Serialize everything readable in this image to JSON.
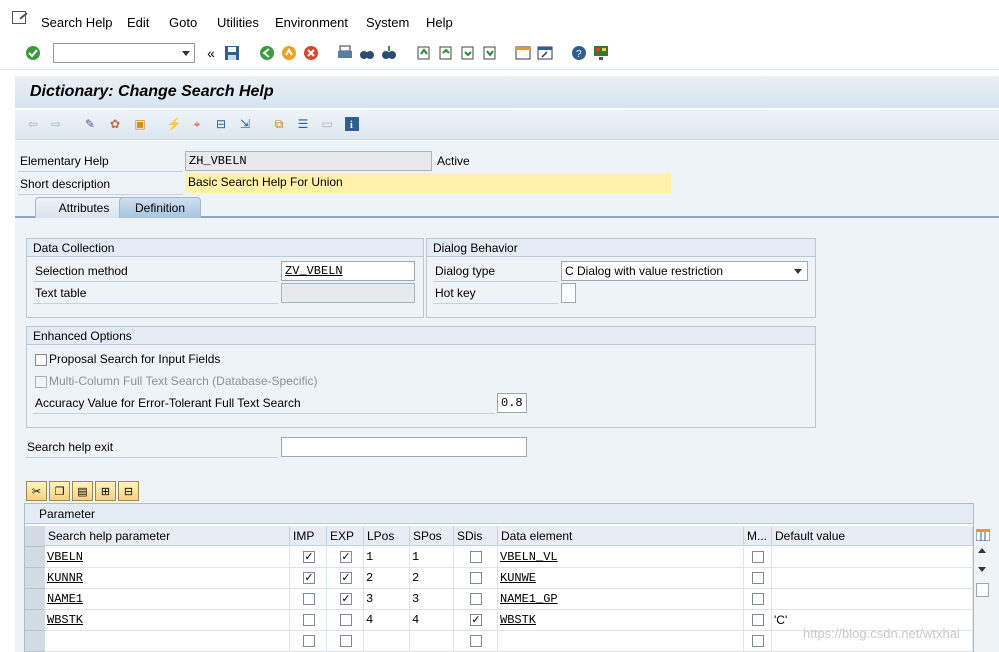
{
  "menu": [
    "Search Help",
    "Edit",
    "Goto",
    "Utilities",
    "Environment",
    "System",
    "Help"
  ],
  "title": "Dictionary: Change Search Help",
  "header": {
    "elementary_help_label": "Elementary Help",
    "elementary_help_value": "ZH_VBELN",
    "status": "Active",
    "short_desc_label": "Short description",
    "short_desc_value": "Basic Search Help For Union"
  },
  "tabs": [
    "Attributes",
    "Definition"
  ],
  "data_collection": {
    "title": "Data Collection",
    "selection_method_label": "Selection method",
    "selection_method_value": "ZV_VBELN",
    "text_table_label": "Text table",
    "text_table_value": ""
  },
  "dialog_behavior": {
    "title": "Dialog Behavior",
    "dialog_type_label": "Dialog type",
    "dialog_type_value": "C Dialog with value restriction",
    "hot_key_label": "Hot key",
    "hot_key_value": ""
  },
  "enhanced": {
    "title": "Enhanced Options",
    "proposal_label": "Proposal Search for Input Fields",
    "multicolumn_label": "Multi-Column Full Text Search (Database-Specific)",
    "accuracy_label": "Accuracy Value for Error-Tolerant Full Text Search",
    "accuracy_value": "0.8"
  },
  "search_help_exit_label": "Search help exit",
  "search_help_exit_value": "",
  "table": {
    "title": "Parameter",
    "columns": [
      "Search help parameter",
      "IMP",
      "EXP",
      "LPos",
      "SPos",
      "SDis",
      "Data element",
      "M...",
      "Default value"
    ],
    "rows": [
      {
        "param": "VBELN",
        "imp": true,
        "exp": true,
        "lpos": "1",
        "spos": "1",
        "sdis": false,
        "element": "VBELN_VL",
        "m": false,
        "default": ""
      },
      {
        "param": "KUNNR",
        "imp": true,
        "exp": true,
        "lpos": "2",
        "spos": "2",
        "sdis": false,
        "element": "KUNWE",
        "m": false,
        "default": ""
      },
      {
        "param": "NAME1",
        "imp": false,
        "exp": true,
        "lpos": "3",
        "spos": "3",
        "sdis": false,
        "element": "NAME1_GP",
        "m": false,
        "default": ""
      },
      {
        "param": "WBSTK",
        "imp": false,
        "exp": false,
        "lpos": "4",
        "spos": "4",
        "sdis": true,
        "element": "WBSTK",
        "m": false,
        "default": "'C'"
      },
      {
        "param": "",
        "imp": false,
        "exp": false,
        "lpos": "",
        "spos": "",
        "sdis": false,
        "element": "",
        "m": false,
        "default": ""
      }
    ]
  },
  "watermark": "https://blog.csdn.net/wtxhai"
}
